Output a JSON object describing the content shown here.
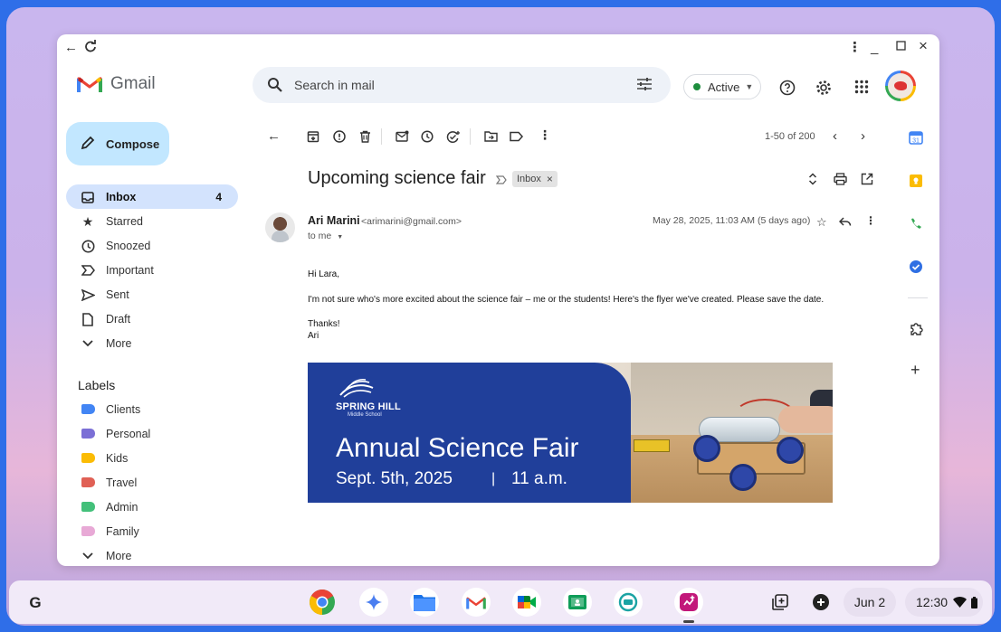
{
  "app": {
    "name": "Gmail"
  },
  "search": {
    "placeholder": "Search in mail"
  },
  "status": {
    "label": "Active",
    "color": "#1e8e3e"
  },
  "compose": {
    "label": "Compose"
  },
  "nav": [
    {
      "label": "Inbox",
      "count": "4",
      "icon": "inbox-icon"
    },
    {
      "label": "Starred",
      "icon": "star-icon"
    },
    {
      "label": "Snoozed",
      "icon": "clock-icon"
    },
    {
      "label": "Important",
      "icon": "important-icon"
    },
    {
      "label": "Sent",
      "icon": "send-icon"
    },
    {
      "label": "Draft",
      "icon": "draft-icon"
    },
    {
      "label": "More",
      "icon": "chevron-down-icon"
    }
  ],
  "labels_title": "Labels",
  "labels": [
    {
      "label": "Clients",
      "color": "#4285f4"
    },
    {
      "label": "Personal",
      "color": "#7b6fd6"
    },
    {
      "label": "Kids",
      "color": "#fbbc04"
    },
    {
      "label": "Travel",
      "color": "#e06055"
    },
    {
      "label": "Admin",
      "color": "#43c07a"
    },
    {
      "label": "Family",
      "color": "#e8a9d6"
    },
    {
      "label": "More",
      "icon": "chevron-down-icon"
    }
  ],
  "toolbar": {
    "pager": "1-50 of 200"
  },
  "message": {
    "subject": "Upcoming science fair",
    "label_chip": "Inbox",
    "sender_name": "Ari Marini",
    "sender_email": "<arimarini@gmail.com>",
    "to": "to me",
    "date": "May 28, 2025, 11:03 AM (5 days ago)",
    "body": {
      "greeting": "Hi Lara,",
      "paragraph": "I'm not sure who's more excited about the science fair – me or the students! Here's the flyer we've created. Please save the date.",
      "signoff": "Thanks!",
      "signature": "Ari"
    }
  },
  "flyer": {
    "school": "SPRING HILL",
    "school_sub": "Middle School",
    "title": "Annual Science Fair",
    "date": "Sept. 5th, 2025",
    "separator": "|",
    "time": "11 a.m.",
    "color": "#203f9a"
  },
  "shelf": {
    "launcher": "G",
    "date": "Jun 2",
    "time": "12:30"
  }
}
